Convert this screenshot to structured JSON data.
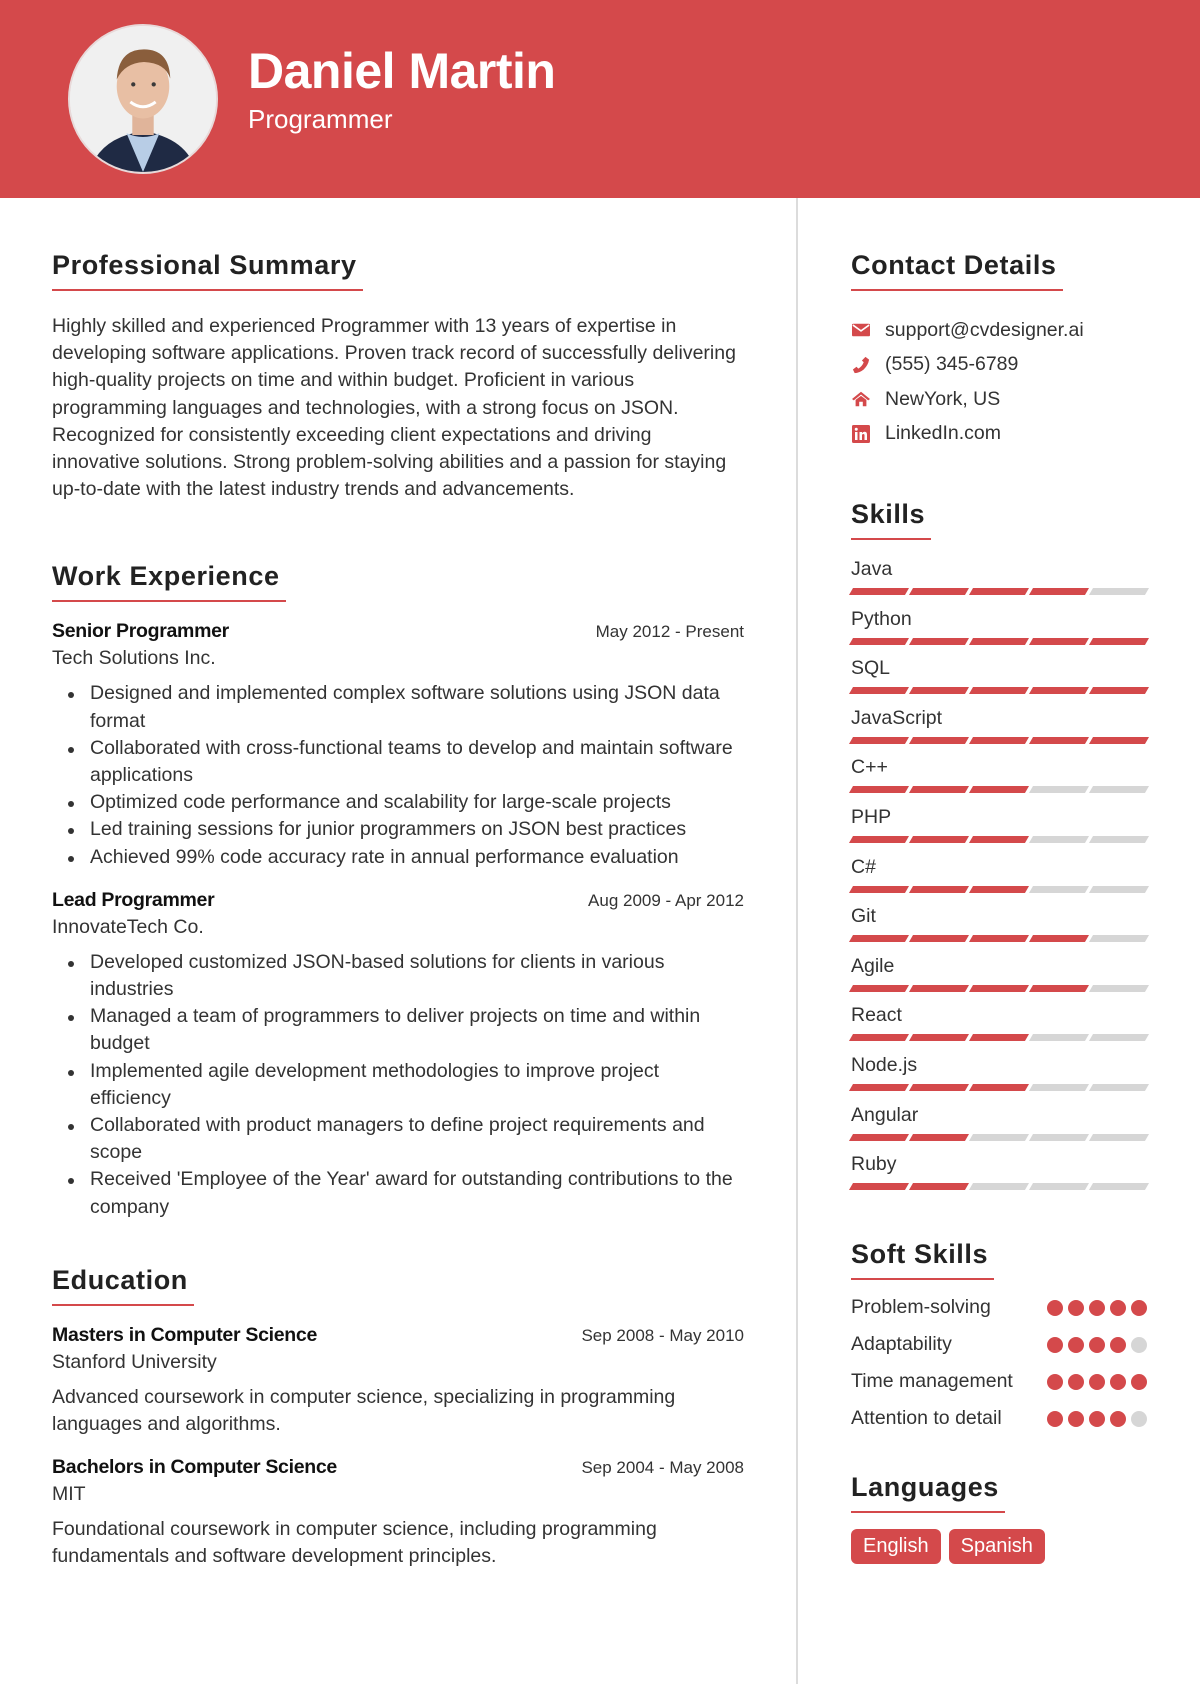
{
  "header": {
    "name": "Daniel Martin",
    "title": "Programmer",
    "accent_color": "#d4494b"
  },
  "summary": {
    "heading": "Professional Summary",
    "text": "Highly skilled and experienced Programmer with 13 years of expertise in developing software applications. Proven track record of successfully delivering high-quality projects on time and within budget. Proficient in various programming languages and technologies, with a strong focus on JSON. Recognized for consistently exceeding client expectations and driving innovative solutions. Strong problem-solving abilities and a passion for staying up-to-date with the latest industry trends and advancements."
  },
  "experience": {
    "heading": "Work Experience",
    "jobs": [
      {
        "role": "Senior Programmer",
        "date": "May 2012 - Present",
        "company": "Tech Solutions Inc.",
        "bullets": [
          "Designed and implemented complex software solutions using JSON data format",
          "Collaborated with cross-functional teams to develop and maintain software applications",
          "Optimized code performance and scalability for large-scale projects",
          "Led training sessions for junior programmers on JSON best practices",
          "Achieved 99% code accuracy rate in annual performance evaluation"
        ]
      },
      {
        "role": "Lead Programmer",
        "date": "Aug 2009 - Apr 2012",
        "company": "InnovateTech Co.",
        "bullets": [
          "Developed customized JSON-based solutions for clients in various industries",
          "Managed a team of programmers to deliver projects on time and within budget",
          "Implemented agile development methodologies to improve project efficiency",
          "Collaborated with product managers to define project requirements and scope",
          "Received 'Employee of the Year' award for outstanding contributions to the company"
        ]
      }
    ]
  },
  "education": {
    "heading": "Education",
    "items": [
      {
        "degree": "Masters in Computer Science",
        "date": "Sep 2008 - May 2010",
        "school": "Stanford University",
        "description": "Advanced coursework in computer science, specializing in programming languages and algorithms."
      },
      {
        "degree": "Bachelors in Computer Science",
        "date": "Sep 2004 - May 2008",
        "school": "MIT",
        "description": "Foundational coursework in computer science, including programming fundamentals and software development principles."
      }
    ]
  },
  "contact": {
    "heading": "Contact Details",
    "items": [
      {
        "icon": "envelope-icon",
        "text": "support@cvdesigner.ai"
      },
      {
        "icon": "phone-icon",
        "text": "(555) 345-6789"
      },
      {
        "icon": "home-icon",
        "text": "NewYork, US"
      },
      {
        "icon": "linkedin-icon",
        "text": "LinkedIn.com"
      }
    ]
  },
  "skills": {
    "heading": "Skills",
    "max_level": 5,
    "items": [
      {
        "name": "Java",
        "level": 4
      },
      {
        "name": "Python",
        "level": 5
      },
      {
        "name": "SQL",
        "level": 5
      },
      {
        "name": "JavaScript",
        "level": 5
      },
      {
        "name": "C++",
        "level": 3
      },
      {
        "name": "PHP",
        "level": 3
      },
      {
        "name": "C#",
        "level": 3
      },
      {
        "name": "Git",
        "level": 4
      },
      {
        "name": "Agile",
        "level": 4
      },
      {
        "name": "React",
        "level": 3
      },
      {
        "name": "Node.js",
        "level": 3
      },
      {
        "name": "Angular",
        "level": 2
      },
      {
        "name": "Ruby",
        "level": 2
      }
    ]
  },
  "soft_skills": {
    "heading": "Soft Skills",
    "max_level": 5,
    "items": [
      {
        "name": "Problem-solving",
        "level": 5
      },
      {
        "name": "Adaptability",
        "level": 4
      },
      {
        "name": "Time management",
        "level": 5
      },
      {
        "name": "Attention to detail",
        "level": 4
      }
    ]
  },
  "languages": {
    "heading": "Languages",
    "items": [
      "English",
      "Spanish"
    ]
  }
}
